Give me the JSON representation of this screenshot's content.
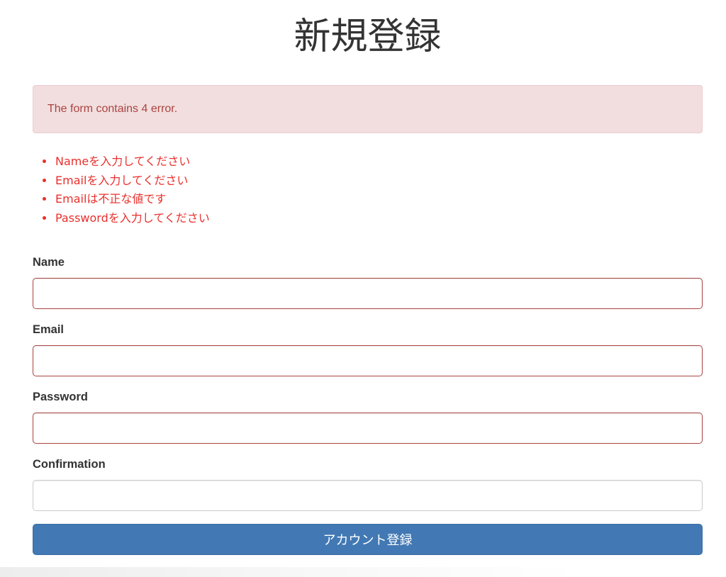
{
  "page": {
    "title": "新規登録"
  },
  "alert": {
    "message": "The form contains 4 error."
  },
  "errors": [
    "Nameを入力してください",
    "Emailを入力してください",
    "Emailは不正な値です",
    "Passwordを入力してください"
  ],
  "form": {
    "fields": [
      {
        "label": "Name",
        "value": "",
        "has_error": true
      },
      {
        "label": "Email",
        "value": "",
        "has_error": true
      },
      {
        "label": "Password",
        "value": "",
        "has_error": true
      },
      {
        "label": "Confirmation",
        "value": "",
        "has_error": false
      }
    ],
    "submit_label": "アカウント登録"
  },
  "colors": {
    "error_text": "#e8302d",
    "alert_bg": "#f2dede",
    "alert_text": "#a94442",
    "error_border": "#a94442",
    "primary_button": "#4279b4"
  }
}
